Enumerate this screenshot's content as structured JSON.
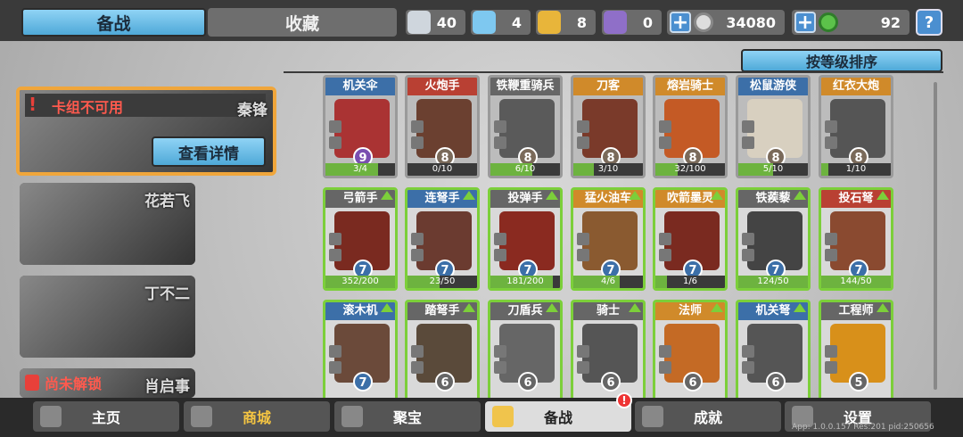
{
  "tabs": {
    "active": "备战",
    "inactive": "收藏"
  },
  "resources": {
    "silver": "40",
    "crystal": "4",
    "gold": "8",
    "purple": "0",
    "coins": "34080",
    "gems": "92"
  },
  "help": "?",
  "sort": "按等级排序",
  "decks": {
    "selected": {
      "name": "秦锋",
      "warning": "卡组不可用",
      "detail": "查看详情"
    },
    "d2": "花若飞",
    "d3": "丁不二",
    "d4": {
      "lock": "尚未解锁",
      "name": "肖启事"
    }
  },
  "cards": [
    {
      "name": "机关伞",
      "lvl": "9",
      "prog": "3/4",
      "p": 0.75
    },
    {
      "name": "火炮手",
      "lvl": "8",
      "prog": "0/10",
      "p": 0
    },
    {
      "name": "铁鞭重骑兵",
      "lvl": "8",
      "prog": "6/10",
      "p": 0.6
    },
    {
      "name": "刀客",
      "lvl": "8",
      "prog": "3/10",
      "p": 0.3
    },
    {
      "name": "熔岩骑士",
      "lvl": "8",
      "prog": "32/100",
      "p": 0.32
    },
    {
      "name": "松鼠游侠",
      "lvl": "8",
      "prog": "5/10",
      "p": 0.5
    },
    {
      "name": "红衣大炮",
      "lvl": "8",
      "prog": "1/10",
      "p": 0.1
    },
    {
      "name": "弓箭手",
      "lvl": "7",
      "prog": "352/200",
      "p": 1
    },
    {
      "name": "连弩手",
      "lvl": "7",
      "prog": "23/50",
      "p": 0.46
    },
    {
      "name": "投弹手",
      "lvl": "7",
      "prog": "181/200",
      "p": 0.9
    },
    {
      "name": "猛火油车",
      "lvl": "7",
      "prog": "4/6",
      "p": 0.67
    },
    {
      "name": "吹箭墨灵",
      "lvl": "7",
      "prog": "1/6",
      "p": 0.17
    },
    {
      "name": "铁蒺藜",
      "lvl": "7",
      "prog": "124/50",
      "p": 1
    },
    {
      "name": "投石弩",
      "lvl": "7",
      "prog": "144/50",
      "p": 1
    },
    {
      "name": "滚木机",
      "lvl": "7",
      "prog": "",
      "p": 0
    },
    {
      "name": "踏弩手",
      "lvl": "6",
      "prog": "",
      "p": 0
    },
    {
      "name": "刀盾兵",
      "lvl": "6",
      "prog": "",
      "p": 0
    },
    {
      "name": "骑士",
      "lvl": "6",
      "prog": "",
      "p": 0
    },
    {
      "name": "法师",
      "lvl": "6",
      "prog": "",
      "p": 0
    },
    {
      "name": "机关弩",
      "lvl": "6",
      "prog": "",
      "p": 0
    },
    {
      "name": "工程师",
      "lvl": "5",
      "prog": "",
      "p": 0
    }
  ],
  "nav": {
    "home": "主页",
    "shop": "商城",
    "treasure": "聚宝",
    "prepare": "备战",
    "achieve": "成就",
    "settings": "设置"
  },
  "badge": "!",
  "version": "App: 1.0.0.157 Res:201 pid:250656"
}
